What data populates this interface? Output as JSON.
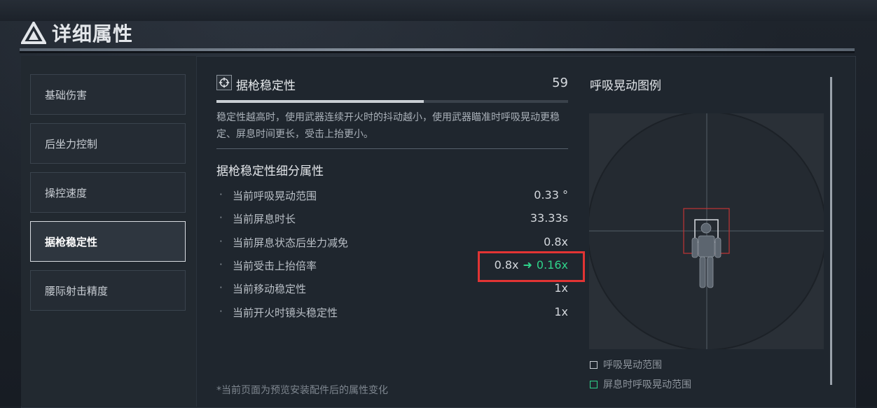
{
  "header": {
    "title": "详细属性"
  },
  "sidebar": {
    "items": [
      {
        "label": "基础伤害"
      },
      {
        "label": "后坐力控制"
      },
      {
        "label": "操控速度"
      },
      {
        "label": "据枪稳定性",
        "active": true
      },
      {
        "label": "腰际射击精度"
      }
    ]
  },
  "stat": {
    "icon": "crosshair-icon",
    "name": "据枪稳定性",
    "value": "59",
    "bar_fraction": 0.59,
    "description": "稳定性越高时，使用武器连续开火时的抖动越小，使用武器瞄准时呼吸晃动更稳定、屏息时间更长，受击上抬更小。"
  },
  "breakdown": {
    "title": "据枪稳定性细分属性",
    "rows": [
      {
        "label": "当前呼吸晃动范围",
        "value": "0.33 °"
      },
      {
        "label": "当前屏息时长",
        "value": "33.33s"
      },
      {
        "label": "当前屏息状态后坐力减免",
        "value": "0.8x"
      },
      {
        "label": "当前受击上抬倍率",
        "value_old": "0.8x",
        "arrow": "➜",
        "value_new": "0.16x"
      },
      {
        "label": "当前移动稳定性",
        "value": "1x"
      },
      {
        "label": "当前开火时镜头稳定性",
        "value": "1x"
      }
    ],
    "bullet": "·"
  },
  "footnote": "*当前页面为预览安装配件后的属性变化",
  "legend": {
    "title": "呼吸晃动图例",
    "items": [
      {
        "label": "呼吸晃动范围",
        "color": "#c9ced4"
      },
      {
        "label": "屏息时呼吸晃动范围",
        "color": "#2fd38a"
      }
    ]
  },
  "colors": {
    "accent_green": "#2fd38a",
    "highlight_red": "#e23434",
    "panel": "#1f262e"
  }
}
